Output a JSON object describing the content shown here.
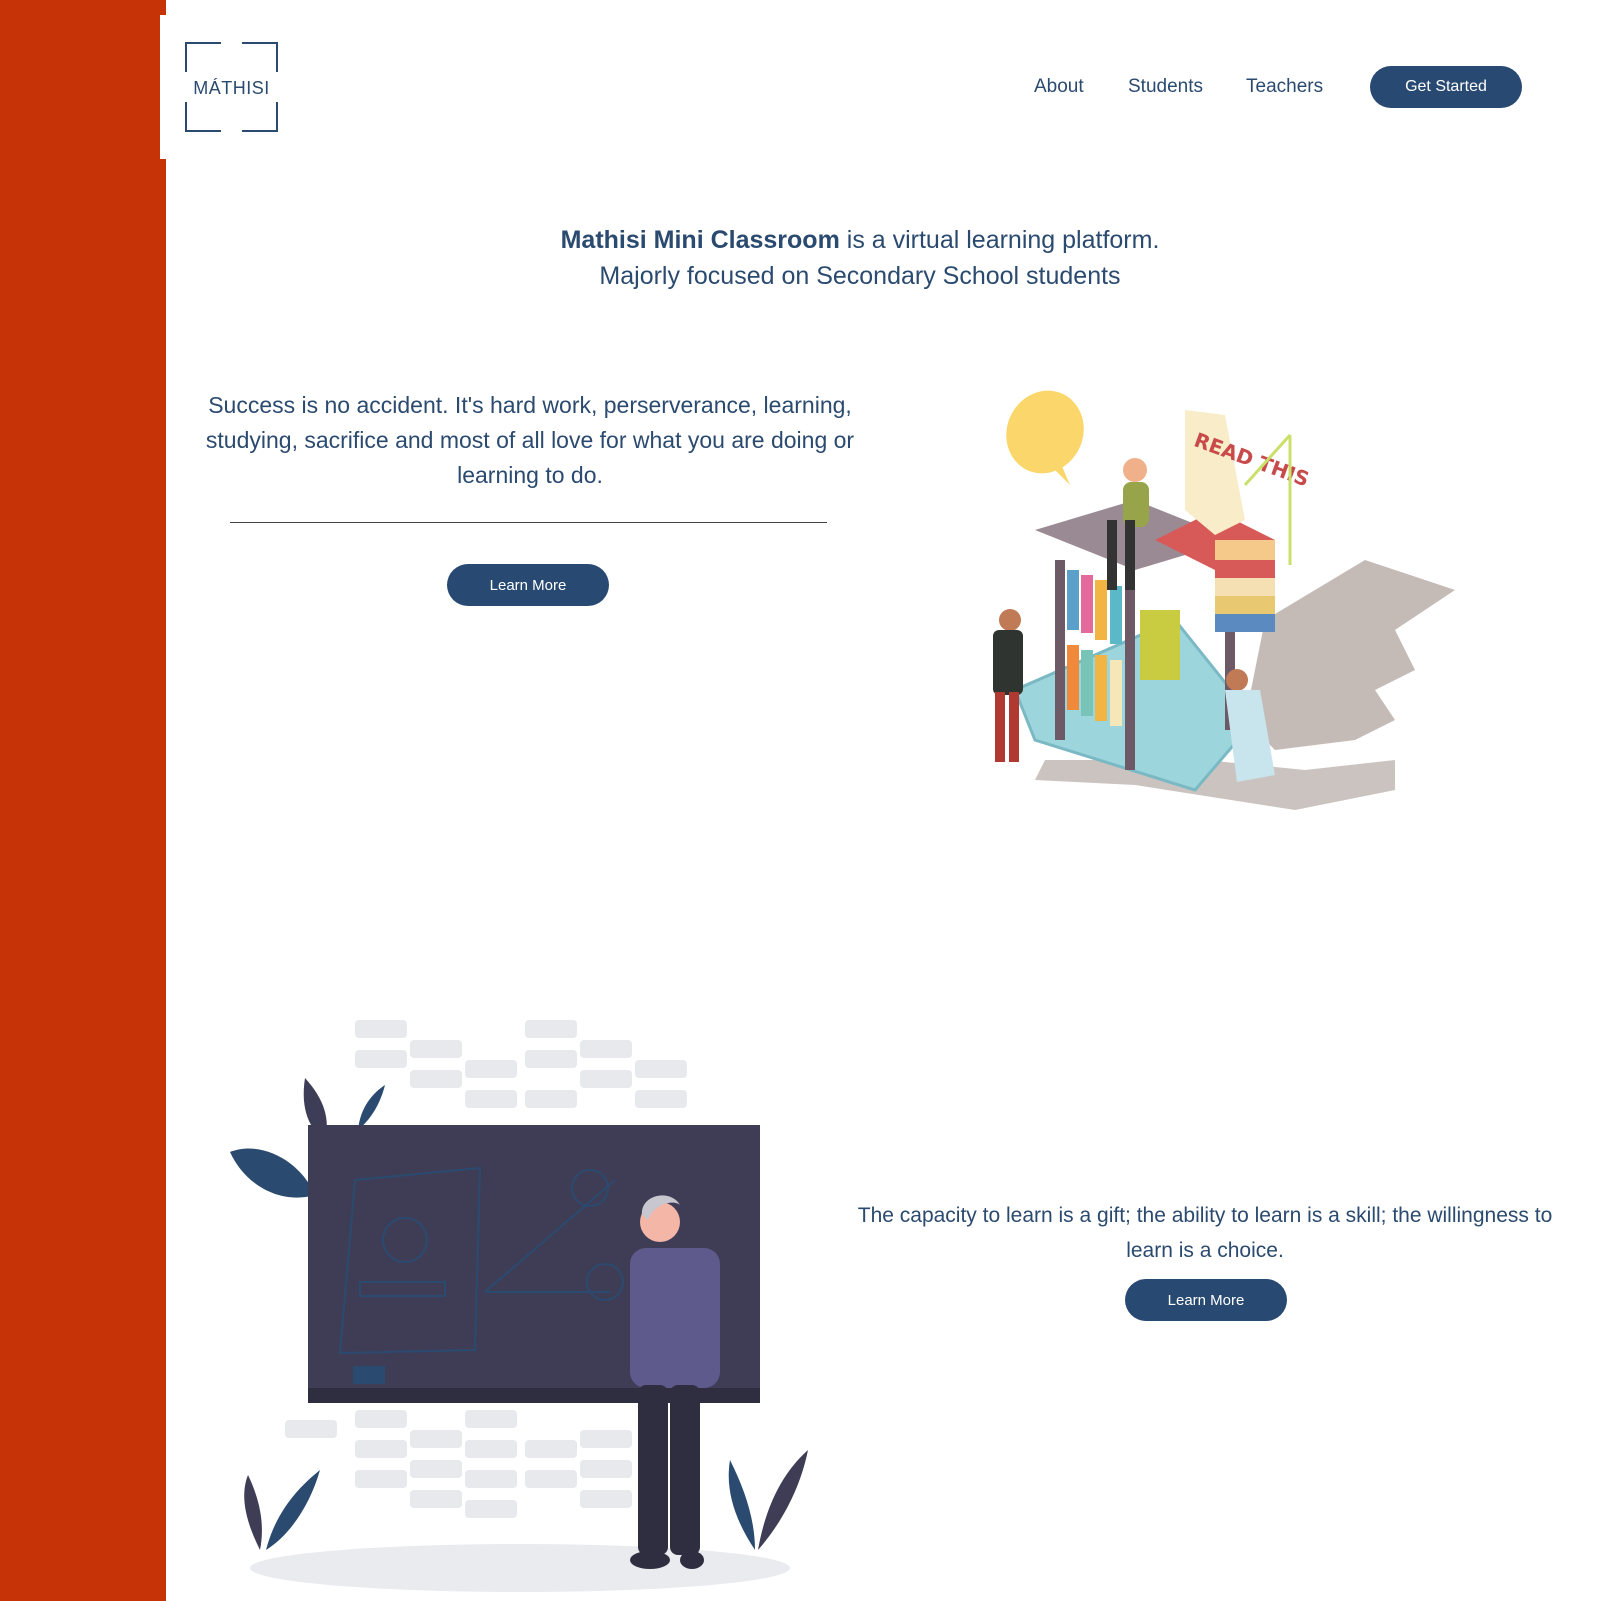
{
  "brand": {
    "logo_text": "MÁTHISI",
    "side_color": "#c63306",
    "primary_color": "#284a72"
  },
  "nav": {
    "items": [
      {
        "label": "About"
      },
      {
        "label": "Students"
      },
      {
        "label": "Teachers"
      }
    ],
    "cta_label": "Get Started"
  },
  "hero": {
    "title_bold": "Mathisi Mini Classroom",
    "title_rest": " is a virtual learning platform.",
    "subtitle": "Majorly focused on Secondary School students"
  },
  "section1": {
    "quote": "Success is no accident. It's hard work, perserverance, learning, studying, sacrifice and most of all love for what you are doing or learning to do.",
    "button_label": "Learn More",
    "illustration_sign_text": "READ THIS"
  },
  "section2": {
    "quote": "The capacity to learn is a gift; the ability to learn is a skill; the willingness to learn is a choice.",
    "button_label": "Learn More"
  }
}
